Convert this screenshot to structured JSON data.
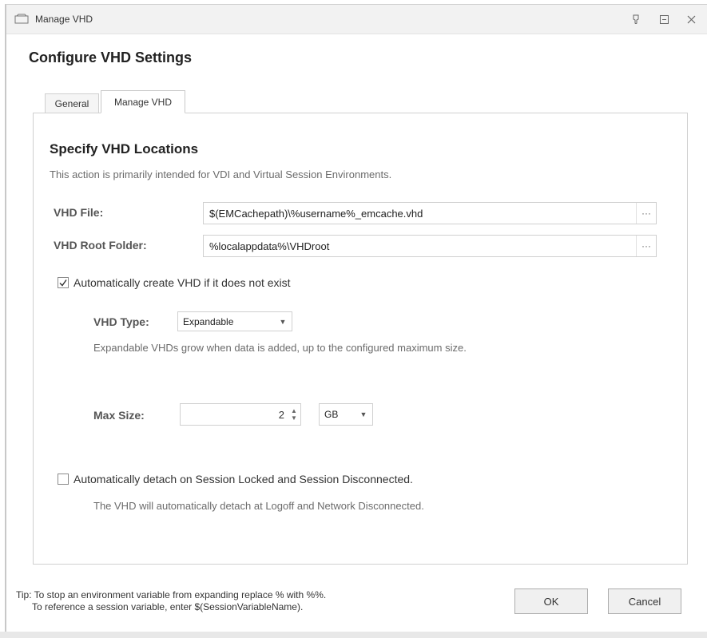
{
  "window": {
    "title": "Manage VHD",
    "pin_glyph": "⚲",
    "restore_glyph": "▣",
    "close_glyph": "✕"
  },
  "heading": "Configure VHD Settings",
  "tabs": [
    {
      "label": "General",
      "active": false
    },
    {
      "label": "Manage VHD",
      "active": true
    }
  ],
  "section": {
    "title": "Specify VHD Locations",
    "subtitle": "This action is primarily intended for VDI and Virtual Session Environments."
  },
  "vhd_file": {
    "label": "VHD File:",
    "value": "$(EMCachepath)\\%username%_emcache.vhd",
    "browse": "···"
  },
  "vhd_root": {
    "label": "VHD Root Folder:",
    "value": "%localappdata%\\VHDroot",
    "browse": "···"
  },
  "auto_create": {
    "checked": true,
    "label": "Automatically create VHD if it does not exist"
  },
  "vhd_type": {
    "label": "VHD Type:",
    "selected": "Expandable",
    "hint": "Expandable VHDs grow when data is added, up to the configured maximum size."
  },
  "max_size": {
    "label": "Max Size:",
    "value": "2",
    "unit": "GB"
  },
  "auto_detach": {
    "checked": false,
    "label": "Automatically detach on Session Locked and Session Disconnected.",
    "hint": "The VHD will automatically detach at Logoff and Network Disconnected."
  },
  "tip": {
    "line1": "Tip: To stop an environment variable from expanding replace % with %%.",
    "line2": "To reference a session variable, enter $(SessionVariableName)."
  },
  "buttons": {
    "ok": "OK",
    "cancel": "Cancel"
  },
  "colors": {
    "titlebar": "#f2f2f2",
    "border": "#d0d0d0",
    "hint_text": "#6b6b6b"
  }
}
